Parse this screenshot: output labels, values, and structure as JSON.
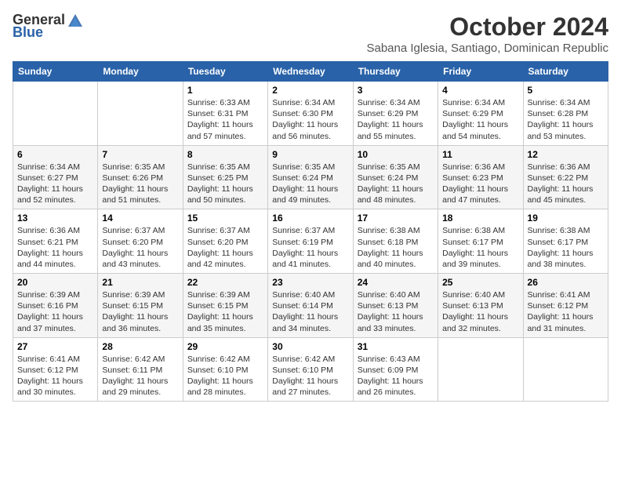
{
  "logo": {
    "general": "General",
    "blue": "Blue"
  },
  "title": "October 2024",
  "location": "Sabana Iglesia, Santiago, Dominican Republic",
  "weekdays": [
    "Sunday",
    "Monday",
    "Tuesday",
    "Wednesday",
    "Thursday",
    "Friday",
    "Saturday"
  ],
  "weeks": [
    [
      {
        "day": "",
        "info": ""
      },
      {
        "day": "",
        "info": ""
      },
      {
        "day": "1",
        "info": "Sunrise: 6:33 AM\nSunset: 6:31 PM\nDaylight: 11 hours and 57 minutes."
      },
      {
        "day": "2",
        "info": "Sunrise: 6:34 AM\nSunset: 6:30 PM\nDaylight: 11 hours and 56 minutes."
      },
      {
        "day": "3",
        "info": "Sunrise: 6:34 AM\nSunset: 6:29 PM\nDaylight: 11 hours and 55 minutes."
      },
      {
        "day": "4",
        "info": "Sunrise: 6:34 AM\nSunset: 6:29 PM\nDaylight: 11 hours and 54 minutes."
      },
      {
        "day": "5",
        "info": "Sunrise: 6:34 AM\nSunset: 6:28 PM\nDaylight: 11 hours and 53 minutes."
      }
    ],
    [
      {
        "day": "6",
        "info": "Sunrise: 6:34 AM\nSunset: 6:27 PM\nDaylight: 11 hours and 52 minutes."
      },
      {
        "day": "7",
        "info": "Sunrise: 6:35 AM\nSunset: 6:26 PM\nDaylight: 11 hours and 51 minutes."
      },
      {
        "day": "8",
        "info": "Sunrise: 6:35 AM\nSunset: 6:25 PM\nDaylight: 11 hours and 50 minutes."
      },
      {
        "day": "9",
        "info": "Sunrise: 6:35 AM\nSunset: 6:24 PM\nDaylight: 11 hours and 49 minutes."
      },
      {
        "day": "10",
        "info": "Sunrise: 6:35 AM\nSunset: 6:24 PM\nDaylight: 11 hours and 48 minutes."
      },
      {
        "day": "11",
        "info": "Sunrise: 6:36 AM\nSunset: 6:23 PM\nDaylight: 11 hours and 47 minutes."
      },
      {
        "day": "12",
        "info": "Sunrise: 6:36 AM\nSunset: 6:22 PM\nDaylight: 11 hours and 45 minutes."
      }
    ],
    [
      {
        "day": "13",
        "info": "Sunrise: 6:36 AM\nSunset: 6:21 PM\nDaylight: 11 hours and 44 minutes."
      },
      {
        "day": "14",
        "info": "Sunrise: 6:37 AM\nSunset: 6:20 PM\nDaylight: 11 hours and 43 minutes."
      },
      {
        "day": "15",
        "info": "Sunrise: 6:37 AM\nSunset: 6:20 PM\nDaylight: 11 hours and 42 minutes."
      },
      {
        "day": "16",
        "info": "Sunrise: 6:37 AM\nSunset: 6:19 PM\nDaylight: 11 hours and 41 minutes."
      },
      {
        "day": "17",
        "info": "Sunrise: 6:38 AM\nSunset: 6:18 PM\nDaylight: 11 hours and 40 minutes."
      },
      {
        "day": "18",
        "info": "Sunrise: 6:38 AM\nSunset: 6:17 PM\nDaylight: 11 hours and 39 minutes."
      },
      {
        "day": "19",
        "info": "Sunrise: 6:38 AM\nSunset: 6:17 PM\nDaylight: 11 hours and 38 minutes."
      }
    ],
    [
      {
        "day": "20",
        "info": "Sunrise: 6:39 AM\nSunset: 6:16 PM\nDaylight: 11 hours and 37 minutes."
      },
      {
        "day": "21",
        "info": "Sunrise: 6:39 AM\nSunset: 6:15 PM\nDaylight: 11 hours and 36 minutes."
      },
      {
        "day": "22",
        "info": "Sunrise: 6:39 AM\nSunset: 6:15 PM\nDaylight: 11 hours and 35 minutes."
      },
      {
        "day": "23",
        "info": "Sunrise: 6:40 AM\nSunset: 6:14 PM\nDaylight: 11 hours and 34 minutes."
      },
      {
        "day": "24",
        "info": "Sunrise: 6:40 AM\nSunset: 6:13 PM\nDaylight: 11 hours and 33 minutes."
      },
      {
        "day": "25",
        "info": "Sunrise: 6:40 AM\nSunset: 6:13 PM\nDaylight: 11 hours and 32 minutes."
      },
      {
        "day": "26",
        "info": "Sunrise: 6:41 AM\nSunset: 6:12 PM\nDaylight: 11 hours and 31 minutes."
      }
    ],
    [
      {
        "day": "27",
        "info": "Sunrise: 6:41 AM\nSunset: 6:12 PM\nDaylight: 11 hours and 30 minutes."
      },
      {
        "day": "28",
        "info": "Sunrise: 6:42 AM\nSunset: 6:11 PM\nDaylight: 11 hours and 29 minutes."
      },
      {
        "day": "29",
        "info": "Sunrise: 6:42 AM\nSunset: 6:10 PM\nDaylight: 11 hours and 28 minutes."
      },
      {
        "day": "30",
        "info": "Sunrise: 6:42 AM\nSunset: 6:10 PM\nDaylight: 11 hours and 27 minutes."
      },
      {
        "day": "31",
        "info": "Sunrise: 6:43 AM\nSunset: 6:09 PM\nDaylight: 11 hours and 26 minutes."
      },
      {
        "day": "",
        "info": ""
      },
      {
        "day": "",
        "info": ""
      }
    ]
  ]
}
